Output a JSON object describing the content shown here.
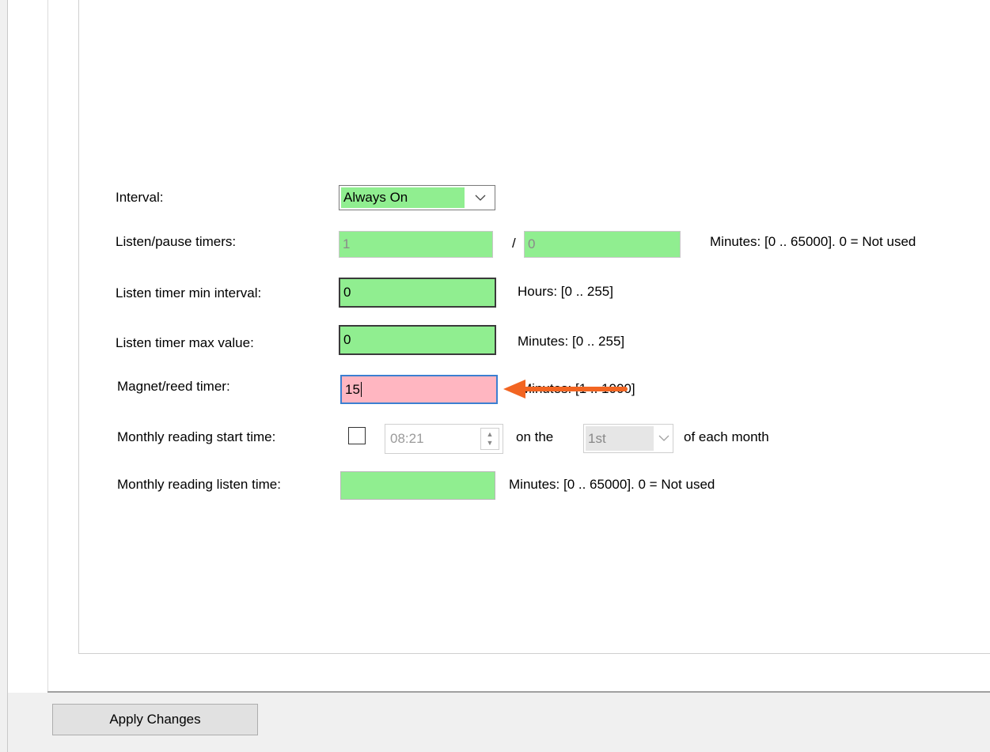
{
  "form": {
    "interval": {
      "label": "Interval:",
      "value": "Always On"
    },
    "listen_pause": {
      "label": "Listen/pause timers:",
      "value_1": "1",
      "separator": "/",
      "value_2": "0",
      "hint": "Minutes: [0 .. 65000]. 0 = Not used"
    },
    "listen_min_interval": {
      "label": "Listen timer min interval:",
      "value": "0",
      "hint": "Hours: [0 .. 255]"
    },
    "listen_max_value": {
      "label": "Listen timer max value:",
      "value": "0",
      "hint": "Minutes: [0 .. 255]"
    },
    "magnet_reed": {
      "label": "Magnet/reed timer:",
      "value": "15",
      "hint": "Minutes: [1 .. 1000]"
    },
    "monthly_start": {
      "label": "Monthly reading start time:",
      "checked": false,
      "time": "08:21",
      "on_the": "on the",
      "day": "1st",
      "suffix": "of each month"
    },
    "monthly_listen": {
      "label": "Monthly reading listen time:",
      "value": "",
      "hint": "Minutes: [0 .. 65000]. 0 = Not used"
    }
  },
  "annotation": {
    "arrow_color": "#f26522"
  },
  "colors": {
    "valid": "#90ee90",
    "invalid": "#ffb6c1",
    "focus_border": "#3c7fd1"
  },
  "footer": {
    "apply_label": "Apply Changes"
  }
}
